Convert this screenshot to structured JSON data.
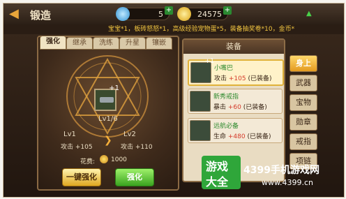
{
  "topbar": {
    "back_icon": "back-arrow-icon",
    "title": "锻造",
    "diamonds": "5",
    "gold": "24575",
    "colors": {
      "accent": "#e8a53a",
      "gold": "#ffd43a",
      "diamond": "#4fb8ff",
      "wifi": "#4ad34a"
    }
  },
  "ticker": {
    "text": "宝宝*1，板砖怒怒*1，高级经验宠物蛋*5，装备抽奖卷*10，金币*"
  },
  "left_tabs": [
    {
      "label": "强化"
    },
    {
      "label": "继承"
    },
    {
      "label": "洗练"
    },
    {
      "label": "升星"
    },
    {
      "label": "镶嵌"
    }
  ],
  "enhance": {
    "level_badge": "Lv1/6",
    "current": {
      "level": "Lv1",
      "stat": "攻击 +105"
    },
    "next": {
      "level": "Lv2",
      "stat": "攻击 +110"
    },
    "cost_label": "花费:",
    "cost_value": "1000",
    "button_one_key": "一键强化",
    "button_enhance": "强化"
  },
  "equip_panel": {
    "title": "装备",
    "items": [
      {
        "name": "小嘴巴",
        "stat_label": "攻击",
        "stat_value": "+105",
        "status": "(已装备)"
      },
      {
        "name": "新秀戒指",
        "stat_label": "暴击",
        "stat_value": "+60",
        "status": "(已装备)"
      },
      {
        "name": "远航必备",
        "stat_label": "生命",
        "stat_value": "+480",
        "status": "(已装备)"
      }
    ]
  },
  "right_tabs": [
    {
      "label": "身上"
    },
    {
      "label": "武器"
    },
    {
      "label": "宝物"
    },
    {
      "label": "勋章"
    },
    {
      "label": "戒指"
    },
    {
      "label": "项链"
    }
  ],
  "watermark": {
    "logo_top": "游戏",
    "logo_bottom": "大全",
    "title": "4399手机游戏网",
    "url": "www.4399.cn"
  }
}
